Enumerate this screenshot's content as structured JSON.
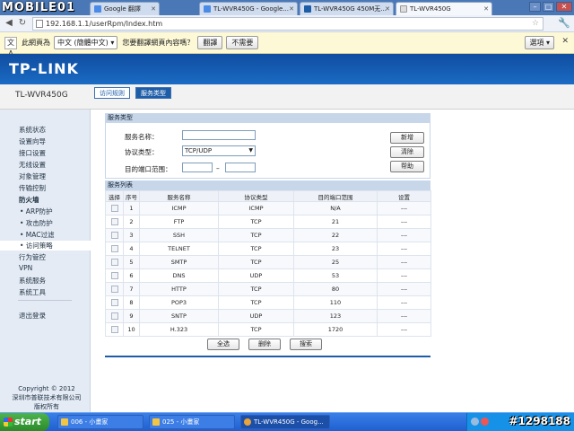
{
  "watermark": {
    "top": "MOBILE01",
    "bottom": "#1298188"
  },
  "browser": {
    "tabs": [
      {
        "title": "Google 翻譯"
      },
      {
        "title": "TL-WVR450G - Google..."
      },
      {
        "title": "TL-WVR450G 450M无..."
      },
      {
        "title": "TL-WVR450G"
      }
    ],
    "url": "192.168.1.1/userRpm/Index.htm",
    "window_buttons": [
      "–",
      "□",
      "✕"
    ]
  },
  "translate_bar": {
    "prefix": "此網頁為",
    "language": "中文 (簡體中文)",
    "question": "您要翻譯網頁內容嗎？",
    "translate_btn": "翻譯",
    "no_btn": "不需要",
    "options_btn": "選項",
    "close": "✕"
  },
  "router": {
    "brand": "TP-LINK",
    "model": "TL-WVR450G",
    "tabs": [
      "访问规则",
      "服务类型"
    ]
  },
  "sidebar": {
    "items": [
      "系统状态",
      "设置向导",
      "接口设置",
      "无线设置",
      "对象管理",
      "传输控制",
      "防火墙",
      "• ARP防护",
      "• 攻击防护",
      "• MAC过滤",
      "• 访问策略",
      "行为管控",
      "VPN",
      "系统服务",
      "系统工具",
      "退出登录"
    ],
    "copyright": [
      "Copyright © 2012",
      "深圳市普联技术有限公司",
      "版权所有"
    ]
  },
  "form": {
    "header": "服务类型",
    "name_label": "服务名称：",
    "protocol_label": "协议类型：",
    "protocol_value": "TCP/UDP",
    "port_label": "目的端口范围：",
    "dash": "–",
    "btn_add": "新增",
    "btn_clear": "清除",
    "btn_help": "帮助"
  },
  "list": {
    "header": "服务列表",
    "columns": [
      "选择",
      "序号",
      "服务名称",
      "协议类型",
      "目的端口范围",
      "设置"
    ],
    "rows": [
      [
        "1",
        "ICMP",
        "ICMP",
        "N/A",
        "---"
      ],
      [
        "2",
        "FTP",
        "TCP",
        "21",
        "---"
      ],
      [
        "3",
        "SSH",
        "TCP",
        "22",
        "---"
      ],
      [
        "4",
        "TELNET",
        "TCP",
        "23",
        "---"
      ],
      [
        "5",
        "SMTP",
        "TCP",
        "25",
        "---"
      ],
      [
        "6",
        "DNS",
        "UDP",
        "53",
        "---"
      ],
      [
        "7",
        "HTTP",
        "TCP",
        "80",
        "---"
      ],
      [
        "8",
        "POP3",
        "TCP",
        "110",
        "---"
      ],
      [
        "9",
        "SNTP",
        "UDP",
        "123",
        "---"
      ],
      [
        "10",
        "H.323",
        "TCP",
        "1720",
        "---"
      ]
    ],
    "btn_select_all": "全选",
    "btn_delete": "删除",
    "btn_search": "搜索"
  },
  "taskbar": {
    "start": "start",
    "tasks": [
      "006 - 小畫家",
      "025 - 小畫家",
      "TL-WVR450G - Goog..."
    ]
  }
}
